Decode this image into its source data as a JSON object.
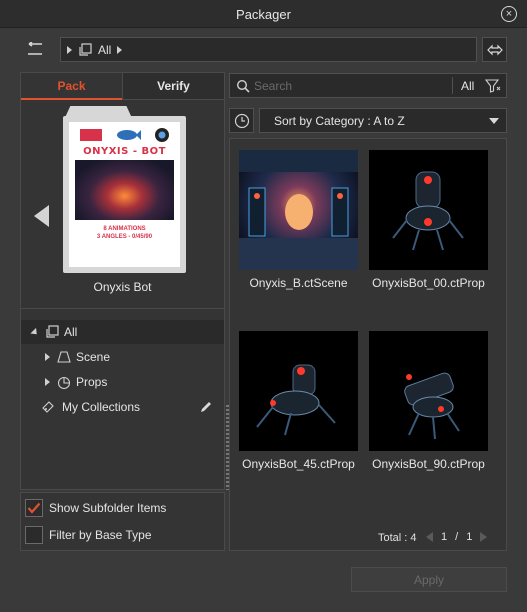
{
  "window": {
    "title": "Packager"
  },
  "path": {
    "segment": "All"
  },
  "tabs": [
    {
      "label": "Pack",
      "active": true
    },
    {
      "label": "Verify",
      "active": false
    }
  ],
  "preview": {
    "name": "Onyxis Bot",
    "poster_title": "ONYXIS - BOT",
    "poster_line1": "8 ANIMATIONS",
    "poster_line2": "3 ANGLES - 0/45/90"
  },
  "tree": [
    {
      "label": "All",
      "icon": "all-folders-icon",
      "selected": true
    },
    {
      "label": "Scene",
      "icon": "scene-icon"
    },
    {
      "label": "Props",
      "icon": "props-icon"
    },
    {
      "label": "My Collections",
      "icon": "collections-icon"
    }
  ],
  "options": {
    "show_subfolder": {
      "label": "Show Subfolder Items",
      "checked": true
    },
    "filter_base": {
      "label": "Filter by Base Type",
      "checked": false
    }
  },
  "search": {
    "placeholder": "Search",
    "scope": "All"
  },
  "sort": {
    "selected": "Sort by Category : A to Z"
  },
  "items": [
    {
      "label": "Onyxis_B.ctScene"
    },
    {
      "label": "OnyxisBot_00.ctProp"
    },
    {
      "label": "OnyxisBot_45.ctProp"
    },
    {
      "label": "OnyxisBot_90.ctProp"
    }
  ],
  "footer": {
    "total": "Total : 4",
    "page": "1",
    "separator": "/",
    "pages": "1"
  },
  "apply_label": "Apply",
  "colors": {
    "accent": "#e2522e",
    "background": "#3a3a3a"
  }
}
